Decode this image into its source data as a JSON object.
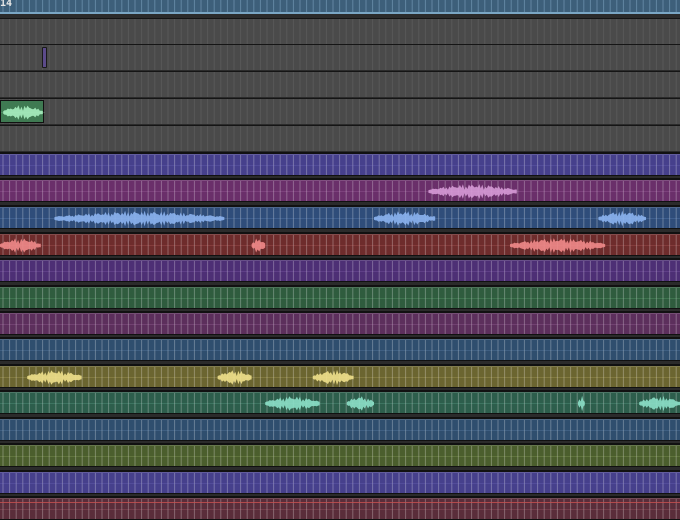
{
  "ruler": {
    "bar_number": "14"
  },
  "colors": {
    "ruler_bg": "#3d5f7a",
    "empty_bg": "#4a4a4a",
    "empty_grid": "#5a5a5a",
    "separator": "#151515",
    "empty_region_purple": "#5c4b8a",
    "empty_region_green": "#3f7a52"
  },
  "tracks": [
    {
      "id": "ruler",
      "type": "ruler",
      "color": "#3b6d8c"
    },
    {
      "id": "e1",
      "type": "empty"
    },
    {
      "id": "e2",
      "type": "empty",
      "mini_region": "purple"
    },
    {
      "id": "e3",
      "type": "empty"
    },
    {
      "id": "e4",
      "type": "empty",
      "mini_region": "green"
    },
    {
      "id": "e5",
      "type": "empty"
    },
    {
      "id": "t1",
      "type": "audio",
      "color": "#46408c",
      "wave": "#8e88e0",
      "clips": []
    },
    {
      "id": "t2",
      "type": "audio",
      "color": "#6a2f6a",
      "wave": "#d69ad6",
      "clips": [
        [
          0.63,
          0.76
        ]
      ]
    },
    {
      "id": "t3",
      "type": "audio",
      "color": "#2f4d7a",
      "wave": "#8cb4f0",
      "clips": [
        [
          0.08,
          0.33
        ],
        [
          0.55,
          0.64
        ],
        [
          0.88,
          0.95
        ]
      ]
    },
    {
      "id": "t4",
      "type": "audio",
      "color": "#6e2c2c",
      "wave": "#f08a8a",
      "clips": [
        [
          0.0,
          0.06
        ],
        [
          0.37,
          0.39
        ],
        [
          0.75,
          0.89
        ]
      ]
    },
    {
      "id": "t5",
      "type": "audio",
      "color": "#4d2f75",
      "wave": "#b48ce0",
      "clips": []
    },
    {
      "id": "t6",
      "type": "audio",
      "color": "#2f5c3e",
      "wave": "#8ce0a4",
      "clips": []
    },
    {
      "id": "t7",
      "type": "audio",
      "color": "#5c2f5c",
      "wave": "#d69ad6",
      "clips": []
    },
    {
      "id": "t8",
      "type": "audio",
      "color": "#2f4e6e",
      "wave": "#8cb4e0",
      "clips": []
    },
    {
      "id": "t9",
      "type": "audio",
      "color": "#6b6530",
      "wave": "#f0e08c",
      "clips": [
        [
          0.04,
          0.12
        ],
        [
          0.32,
          0.37
        ],
        [
          0.46,
          0.52
        ]
      ]
    },
    {
      "id": "t10",
      "type": "audio",
      "color": "#2d5e4c",
      "wave": "#8ce0c8",
      "clips": [
        [
          0.39,
          0.47
        ],
        [
          0.51,
          0.55
        ],
        [
          0.85,
          0.86
        ],
        [
          0.94,
          1.0
        ]
      ]
    },
    {
      "id": "t11",
      "type": "audio",
      "color": "#2f4e6e",
      "wave": "#8cb4e0",
      "clips": []
    },
    {
      "id": "t12",
      "type": "audio",
      "color": "#4b5e2d",
      "wave": "#c8e08c",
      "clips": []
    },
    {
      "id": "t13",
      "type": "audio",
      "color": "#46408c",
      "wave": "#8e88e0",
      "clips": []
    },
    {
      "id": "t14",
      "type": "audio",
      "color": "#5a2d3a",
      "wave": "#f08aa0",
      "clips": []
    }
  ]
}
